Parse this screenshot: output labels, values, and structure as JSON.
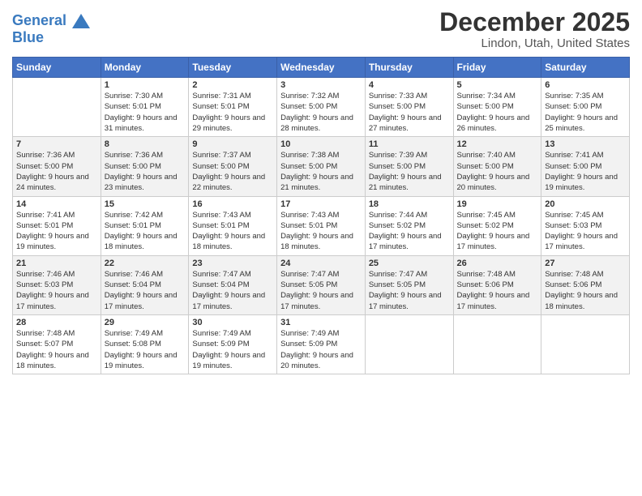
{
  "header": {
    "logo_line1": "General",
    "logo_line2": "Blue",
    "month_title": "December 2025",
    "location": "Lindon, Utah, United States"
  },
  "weekdays": [
    "Sunday",
    "Monday",
    "Tuesday",
    "Wednesday",
    "Thursday",
    "Friday",
    "Saturday"
  ],
  "weeks": [
    [
      {
        "day": "",
        "sunrise": "",
        "sunset": "",
        "daylight": ""
      },
      {
        "day": "1",
        "sunrise": "Sunrise: 7:30 AM",
        "sunset": "Sunset: 5:01 PM",
        "daylight": "Daylight: 9 hours and 31 minutes."
      },
      {
        "day": "2",
        "sunrise": "Sunrise: 7:31 AM",
        "sunset": "Sunset: 5:01 PM",
        "daylight": "Daylight: 9 hours and 29 minutes."
      },
      {
        "day": "3",
        "sunrise": "Sunrise: 7:32 AM",
        "sunset": "Sunset: 5:00 PM",
        "daylight": "Daylight: 9 hours and 28 minutes."
      },
      {
        "day": "4",
        "sunrise": "Sunrise: 7:33 AM",
        "sunset": "Sunset: 5:00 PM",
        "daylight": "Daylight: 9 hours and 27 minutes."
      },
      {
        "day": "5",
        "sunrise": "Sunrise: 7:34 AM",
        "sunset": "Sunset: 5:00 PM",
        "daylight": "Daylight: 9 hours and 26 minutes."
      },
      {
        "day": "6",
        "sunrise": "Sunrise: 7:35 AM",
        "sunset": "Sunset: 5:00 PM",
        "daylight": "Daylight: 9 hours and 25 minutes."
      }
    ],
    [
      {
        "day": "7",
        "sunrise": "Sunrise: 7:36 AM",
        "sunset": "Sunset: 5:00 PM",
        "daylight": "Daylight: 9 hours and 24 minutes."
      },
      {
        "day": "8",
        "sunrise": "Sunrise: 7:36 AM",
        "sunset": "Sunset: 5:00 PM",
        "daylight": "Daylight: 9 hours and 23 minutes."
      },
      {
        "day": "9",
        "sunrise": "Sunrise: 7:37 AM",
        "sunset": "Sunset: 5:00 PM",
        "daylight": "Daylight: 9 hours and 22 minutes."
      },
      {
        "day": "10",
        "sunrise": "Sunrise: 7:38 AM",
        "sunset": "Sunset: 5:00 PM",
        "daylight": "Daylight: 9 hours and 21 minutes."
      },
      {
        "day": "11",
        "sunrise": "Sunrise: 7:39 AM",
        "sunset": "Sunset: 5:00 PM",
        "daylight": "Daylight: 9 hours and 21 minutes."
      },
      {
        "day": "12",
        "sunrise": "Sunrise: 7:40 AM",
        "sunset": "Sunset: 5:00 PM",
        "daylight": "Daylight: 9 hours and 20 minutes."
      },
      {
        "day": "13",
        "sunrise": "Sunrise: 7:41 AM",
        "sunset": "Sunset: 5:00 PM",
        "daylight": "Daylight: 9 hours and 19 minutes."
      }
    ],
    [
      {
        "day": "14",
        "sunrise": "Sunrise: 7:41 AM",
        "sunset": "Sunset: 5:01 PM",
        "daylight": "Daylight: 9 hours and 19 minutes."
      },
      {
        "day": "15",
        "sunrise": "Sunrise: 7:42 AM",
        "sunset": "Sunset: 5:01 PM",
        "daylight": "Daylight: 9 hours and 18 minutes."
      },
      {
        "day": "16",
        "sunrise": "Sunrise: 7:43 AM",
        "sunset": "Sunset: 5:01 PM",
        "daylight": "Daylight: 9 hours and 18 minutes."
      },
      {
        "day": "17",
        "sunrise": "Sunrise: 7:43 AM",
        "sunset": "Sunset: 5:01 PM",
        "daylight": "Daylight: 9 hours and 18 minutes."
      },
      {
        "day": "18",
        "sunrise": "Sunrise: 7:44 AM",
        "sunset": "Sunset: 5:02 PM",
        "daylight": "Daylight: 9 hours and 17 minutes."
      },
      {
        "day": "19",
        "sunrise": "Sunrise: 7:45 AM",
        "sunset": "Sunset: 5:02 PM",
        "daylight": "Daylight: 9 hours and 17 minutes."
      },
      {
        "day": "20",
        "sunrise": "Sunrise: 7:45 AM",
        "sunset": "Sunset: 5:03 PM",
        "daylight": "Daylight: 9 hours and 17 minutes."
      }
    ],
    [
      {
        "day": "21",
        "sunrise": "Sunrise: 7:46 AM",
        "sunset": "Sunset: 5:03 PM",
        "daylight": "Daylight: 9 hours and 17 minutes."
      },
      {
        "day": "22",
        "sunrise": "Sunrise: 7:46 AM",
        "sunset": "Sunset: 5:04 PM",
        "daylight": "Daylight: 9 hours and 17 minutes."
      },
      {
        "day": "23",
        "sunrise": "Sunrise: 7:47 AM",
        "sunset": "Sunset: 5:04 PM",
        "daylight": "Daylight: 9 hours and 17 minutes."
      },
      {
        "day": "24",
        "sunrise": "Sunrise: 7:47 AM",
        "sunset": "Sunset: 5:05 PM",
        "daylight": "Daylight: 9 hours and 17 minutes."
      },
      {
        "day": "25",
        "sunrise": "Sunrise: 7:47 AM",
        "sunset": "Sunset: 5:05 PM",
        "daylight": "Daylight: 9 hours and 17 minutes."
      },
      {
        "day": "26",
        "sunrise": "Sunrise: 7:48 AM",
        "sunset": "Sunset: 5:06 PM",
        "daylight": "Daylight: 9 hours and 17 minutes."
      },
      {
        "day": "27",
        "sunrise": "Sunrise: 7:48 AM",
        "sunset": "Sunset: 5:06 PM",
        "daylight": "Daylight: 9 hours and 18 minutes."
      }
    ],
    [
      {
        "day": "28",
        "sunrise": "Sunrise: 7:48 AM",
        "sunset": "Sunset: 5:07 PM",
        "daylight": "Daylight: 9 hours and 18 minutes."
      },
      {
        "day": "29",
        "sunrise": "Sunrise: 7:49 AM",
        "sunset": "Sunset: 5:08 PM",
        "daylight": "Daylight: 9 hours and 19 minutes."
      },
      {
        "day": "30",
        "sunrise": "Sunrise: 7:49 AM",
        "sunset": "Sunset: 5:09 PM",
        "daylight": "Daylight: 9 hours and 19 minutes."
      },
      {
        "day": "31",
        "sunrise": "Sunrise: 7:49 AM",
        "sunset": "Sunset: 5:09 PM",
        "daylight": "Daylight: 9 hours and 20 minutes."
      },
      {
        "day": "",
        "sunrise": "",
        "sunset": "",
        "daylight": ""
      },
      {
        "day": "",
        "sunrise": "",
        "sunset": "",
        "daylight": ""
      },
      {
        "day": "",
        "sunrise": "",
        "sunset": "",
        "daylight": ""
      }
    ]
  ]
}
